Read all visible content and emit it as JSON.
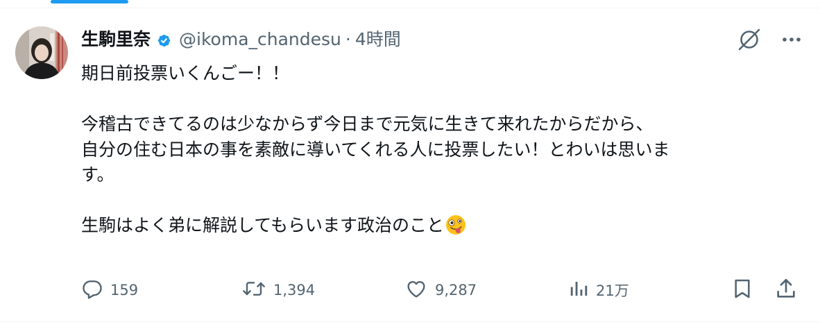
{
  "tweet": {
    "author_name": "生駒里奈",
    "handle": "@ikoma_chandesu",
    "separator": "·",
    "time": "4時間",
    "lines": [
      "期日前投票いくんごー！！",
      "",
      "今稽古できてるのは少なからず今日まで元気に生きて来れたからだから、",
      "自分の住む日本の事を素敵に導いてくれる人に投票したい！とわいは思いま",
      "す。",
      "",
      "生駒はよく弟に解説してもらいます政治のこと"
    ],
    "emoji": "zany-face-emoji"
  },
  "actions": {
    "replies": "159",
    "retweets": "1,394",
    "likes": "9,287",
    "views": "21万"
  },
  "icons": {
    "verified": "verified-badge-icon",
    "grok": "grok-icon",
    "more": "more-icon",
    "reply": "reply-icon",
    "retweet": "retweet-icon",
    "like": "heart-icon",
    "views": "views-icon",
    "bookmark": "bookmark-icon",
    "share": "share-icon"
  },
  "colors": {
    "accent": "#1d9bf0",
    "text": "#0f1419",
    "secondary": "#536471",
    "border": "#eff3f4"
  }
}
